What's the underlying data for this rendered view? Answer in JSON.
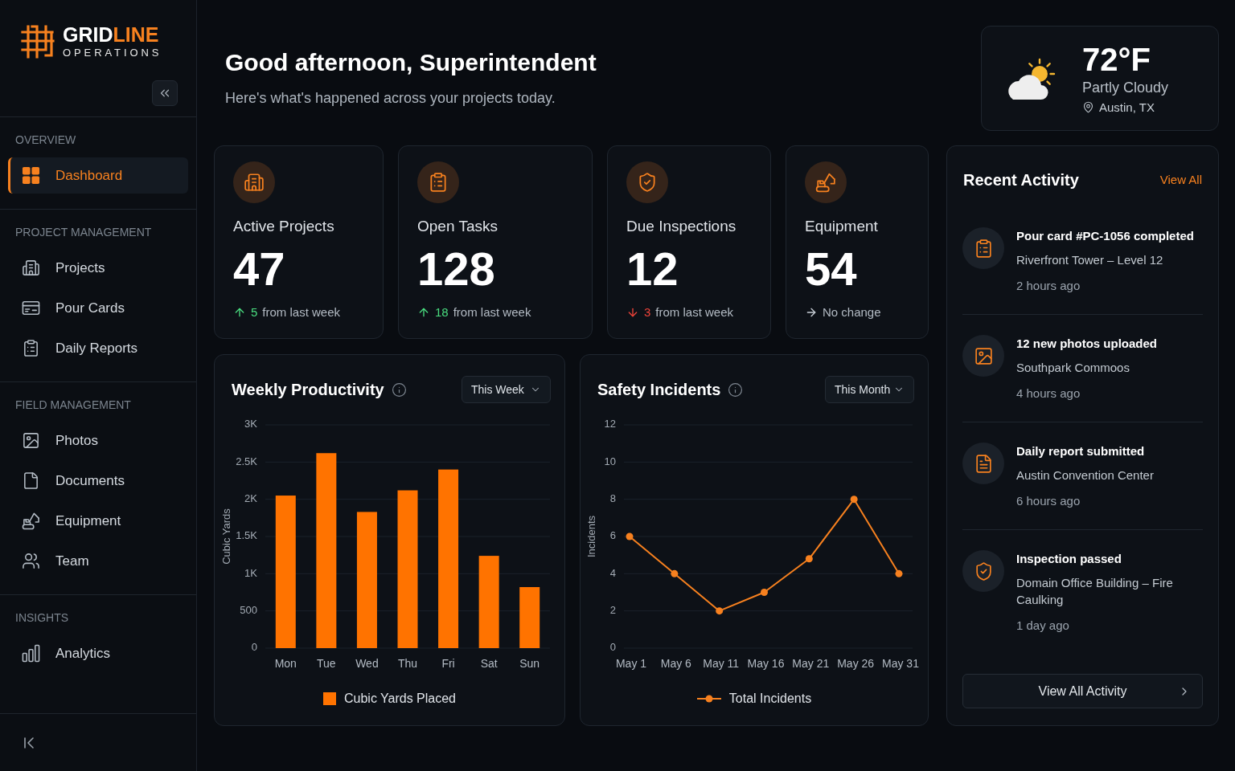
{
  "sidebar": {
    "brand": {
      "name_start": "GRID",
      "name_end": "LINE",
      "tagline": "OPERATIONS"
    },
    "sections": [
      {
        "title": "OVERVIEW",
        "items": [
          {
            "label": "Dashboard",
            "selected": true
          }
        ]
      },
      {
        "title": "PROJECT MANAGEMENT",
        "items": [
          {
            "label": "Projects",
            "selected": false
          },
          {
            "label": "Pour Cards",
            "selected": false
          },
          {
            "label": "Daily Reports",
            "selected": false
          }
        ]
      },
      {
        "title": "FIELD MANAGEMENT",
        "items": [
          {
            "label": "Photos",
            "selected": false
          },
          {
            "label": "Documents",
            "selected": false
          },
          {
            "label": "Equipment",
            "selected": false
          },
          {
            "label": "Team",
            "selected": false
          }
        ]
      },
      {
        "title": "INSIGHTS",
        "items": [
          {
            "label": "Analytics",
            "selected": false
          }
        ]
      }
    ]
  },
  "header": {
    "greeting": "Good afternoon, Superintendent",
    "subtitle": "Here's what's happened across your projects today."
  },
  "weather": {
    "temperature": "72°F",
    "condition": "Partly Cloudy",
    "location": "Austin, TX"
  },
  "stats": [
    {
      "label": "Active Projects",
      "value": "47",
      "change": {
        "kind": "up",
        "amount": "5",
        "text": "from last week"
      }
    },
    {
      "label": "Open Tasks",
      "value": "128",
      "change": {
        "kind": "up",
        "amount": "18",
        "text": "from last week"
      }
    },
    {
      "label": "Due Inspections",
      "value": "12",
      "change": {
        "kind": "down",
        "amount": "3",
        "text": "from last week"
      }
    },
    {
      "label": "Equipment",
      "value": "54",
      "change": {
        "kind": "flat",
        "text": "No change"
      }
    }
  ],
  "charts": [
    {
      "title": "Weekly Productivity",
      "period": "This Week",
      "chart_data": {
        "type": "bar",
        "ylabel": "Cubic Yards",
        "categories": [
          "Mon",
          "Tue",
          "Wed",
          "Thu",
          "Fri",
          "Sat",
          "Sun"
        ],
        "series": [
          {
            "name": "Cubic Yards Placed",
            "color": "#ff7300",
            "values": [
              2050,
              2620,
              1830,
              2120,
              2400,
              1240,
              820
            ]
          }
        ],
        "ylim": [
          0,
          3000
        ],
        "yticks": [
          {
            "value": 0,
            "label": "0"
          },
          {
            "value": 500,
            "label": "500"
          },
          {
            "value": 1000,
            "label": "1K"
          },
          {
            "value": 1500,
            "label": "1.5K"
          },
          {
            "value": 2000,
            "label": "2K"
          },
          {
            "value": 2500,
            "label": "2.5K"
          },
          {
            "value": 3000,
            "label": "3K"
          }
        ],
        "grid": true
      }
    },
    {
      "title": "Safety Incidents",
      "period": "This Month",
      "chart_data": {
        "type": "line",
        "ylabel": "Incidents",
        "categories": [
          "May 1",
          "May 6",
          "May 11",
          "May 16",
          "May 21",
          "May 26",
          "May 31"
        ],
        "series": [
          {
            "name": "Total Incidents",
            "color": "#f7811f",
            "marker": "circle",
            "values": [
              6,
              4,
              2,
              3,
              4.8,
              8,
              4
            ]
          }
        ],
        "ylim": [
          0,
          12
        ],
        "yticks": [
          0,
          2,
          4,
          6,
          8,
          10,
          12
        ],
        "grid": true
      }
    }
  ],
  "activity": {
    "title": "Recent Activity",
    "link": "View All",
    "items": [
      {
        "title": "Pour card #PC-1056 completed",
        "subtitle": "Riverfront Tower – Level 12",
        "time": "2 hours ago"
      },
      {
        "title": "12 new photos uploaded",
        "subtitle": "Southpark Commoos",
        "time": "4 hours ago"
      },
      {
        "title": "Daily report submitted",
        "subtitle": "Austin Convention Center",
        "time": "6 hours ago"
      },
      {
        "title": "Inspection passed",
        "subtitle": "Domain Office Building – Fire Caulking",
        "time": "1 day ago"
      }
    ],
    "button": "View All Activity"
  }
}
